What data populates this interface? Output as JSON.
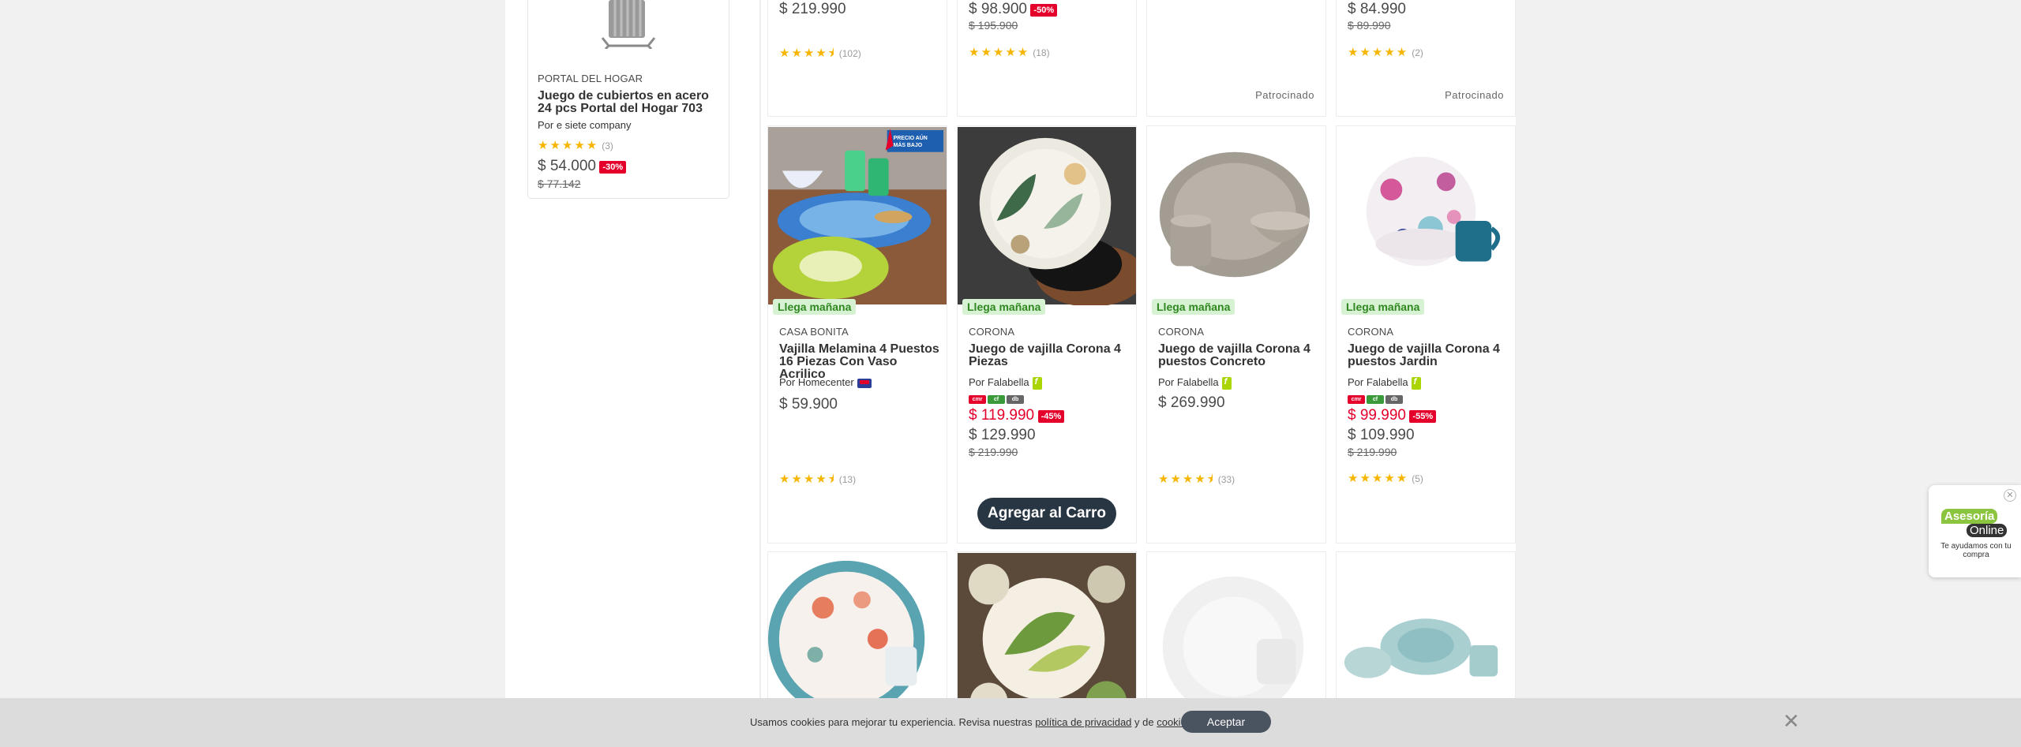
{
  "sidebar_card": {
    "brand": "PORTAL DEL HOGAR",
    "name": "Juego de cubiertos en acero 24 pcs Portal del Hogar 703",
    "seller": "Por e siete company",
    "stars": "★★★★★",
    "reviews": "(3)",
    "price": "$ 54.000",
    "discount": "-30%",
    "old_price": "$ 77.142"
  },
  "top_row": [
    {
      "price": "$ 219.990",
      "stars": "★★★★⯨",
      "reviews": "(102)"
    },
    {
      "price": "$ 98.900",
      "discount": "-50%",
      "old_price": "$ 195.900",
      "stars": "★★★★★",
      "reviews": "(18)"
    },
    {
      "sponsored": "Patrocinado"
    },
    {
      "price": "$ 84.990",
      "old_price": "$ 89.990",
      "stars": "★★★★★",
      "reviews": "(2)",
      "sponsored": "Patrocinado"
    }
  ],
  "middle_row": [
    {
      "badge": "Llega mañana",
      "brand": "CASA BONITA",
      "name": "Vajilla Melamina 4 Puestos 16 Piezas Con Vaso Acrilico",
      "seller": "Por Homecenter",
      "price": "$ 59.900",
      "stars": "★★★★⯨",
      "reviews": "(13)",
      "promo_tag": "PRECIO AÚN MÁS BAJO"
    },
    {
      "badge": "Llega mañana",
      "brand": "CORONA",
      "name": "Juego de vajilla Corona 4 Piezas",
      "seller": "Por Falabella",
      "card_price": "$ 119.990",
      "discount": "-45%",
      "price": "$ 129.990",
      "old_price": "$ 219.990"
    },
    {
      "badge": "Llega mañana",
      "brand": "CORONA",
      "name": "Juego de vajilla Corona 4 puestos Concreto",
      "seller": "Por Falabella",
      "price": "$ 269.990",
      "stars": "★★★★⯨",
      "reviews": "(33)"
    },
    {
      "badge": "Llega mañana",
      "brand": "CORONA",
      "name": "Juego de vajilla Corona 4 puestos Jardin",
      "seller": "Por Falabella",
      "card_price": "$ 99.990",
      "discount": "-55%",
      "price": "$ 109.990",
      "old_price": "$ 219.990",
      "stars": "★★★★★",
      "reviews": "(5)"
    }
  ],
  "add_to_cart": "Agregar al Carro",
  "cookies": {
    "text_before": "Usamos cookies para mejorar tu experiencia. Revisa nuestras ",
    "privacy_link": "política de privacidad",
    "text_mid": " y de ",
    "cookies_link": "cookies",
    "text_after": ".",
    "accept": "Aceptar",
    "close": "✕"
  },
  "asesoria": {
    "close": "✕",
    "line1": "Asesoría",
    "line2": "Online",
    "sub": "Te ayudamos con tu compra"
  },
  "colors": {
    "accent_red": "#e4002b",
    "star": "#f7b500",
    "delivery_green": "#30871f",
    "button_dark": "#283542"
  }
}
